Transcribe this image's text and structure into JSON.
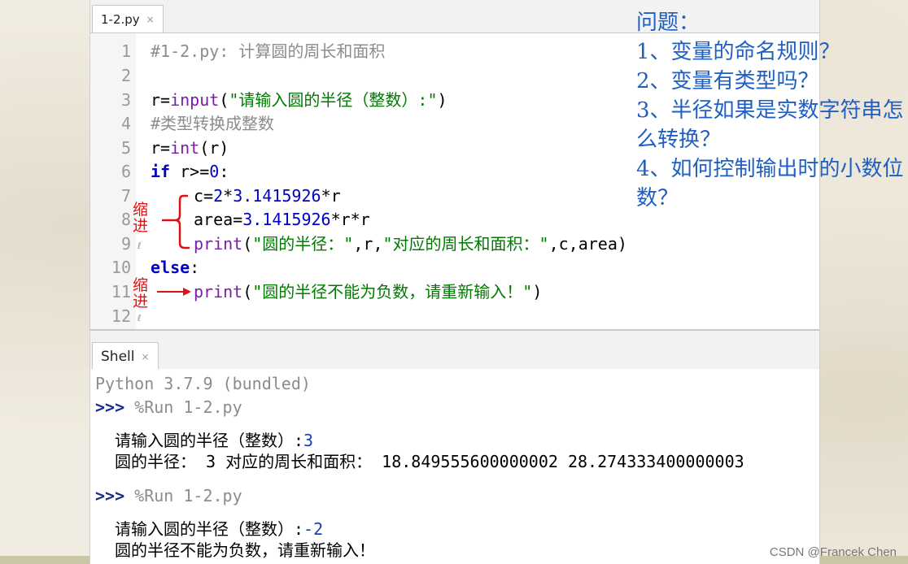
{
  "editor": {
    "tab_label": "1-2.py",
    "tab_close": "×",
    "line_numbers": [
      "1",
      "2",
      "3",
      "4",
      "5",
      "6",
      "7",
      "8",
      "9",
      "10",
      "11",
      "12"
    ],
    "lines": {
      "l1": "#1-2.py: 计算圆的周长和面积",
      "l3_a": "r=",
      "l3_b": "input",
      "l3_c": "(",
      "l3_d": "\"请输入圆的半径（整数）:\"",
      "l3_e": ")",
      "l4": "#类型转换成整数",
      "l5_a": "r=",
      "l5_b": "int",
      "l5_c": "(r)",
      "l6_a": "if",
      "l6_b": " r>=",
      "l6_c": "0",
      "l6_d": ":",
      "l7_a": "c=",
      "l7_b": "2",
      "l7_c": "*",
      "l7_d": "3.1415926",
      "l7_e": "*r",
      "l8_a": "area=",
      "l8_b": "3.1415926",
      "l8_c": "*r*r",
      "l9_a": "print",
      "l9_b": "(",
      "l9_c": "\"圆的半径：\"",
      "l9_d": ",r,",
      "l9_e": "\"对应的周长和面积：\"",
      "l9_f": ",c,area)",
      "l10_a": "else",
      "l10_b": ":",
      "l11_a": "print",
      "l11_b": "(",
      "l11_c": "\"圆的半径不能为负数，请重新输入！\"",
      "l11_d": ")"
    },
    "pilcrow": "ℓ"
  },
  "annotations": {
    "indent_1": "缩进",
    "indent_2": "缩进"
  },
  "shell": {
    "tab_label": "Shell",
    "tab_close": "×",
    "banner": "Python 3.7.9 (bundled)",
    "prompt": ">>>",
    "run_cmd_1": " %Run 1-2.py",
    "out1_prompt": "请输入圆的半径（整数）:",
    "out1_input": "3",
    "out1_result": "圆的半径： 3 对应的周长和面积： 18.849555600000002 28.274333400000003",
    "run_cmd_2": " %Run 1-2.py",
    "out2_prompt": "请输入圆的半径（整数）:",
    "out2_input": "-2",
    "out2_result": "圆的半径不能为负数，请重新输入！"
  },
  "questions": {
    "title": "问题：",
    "q1": "1、变量的命名规则？",
    "q2": "2、变量有类型吗？",
    "q3": "3、半径如果是实数字符串怎么转换？",
    "q4": "4、如何控制输出时的小数位数？"
  },
  "watermark": "CSDN @Francek Chen",
  "colors": {
    "keyword": "#0000c8",
    "builtin": "#7a1fa2",
    "string": "#007a00",
    "comment": "#8c8c8c",
    "annotation": "#e01010",
    "question_text": "#1f5fc4"
  }
}
